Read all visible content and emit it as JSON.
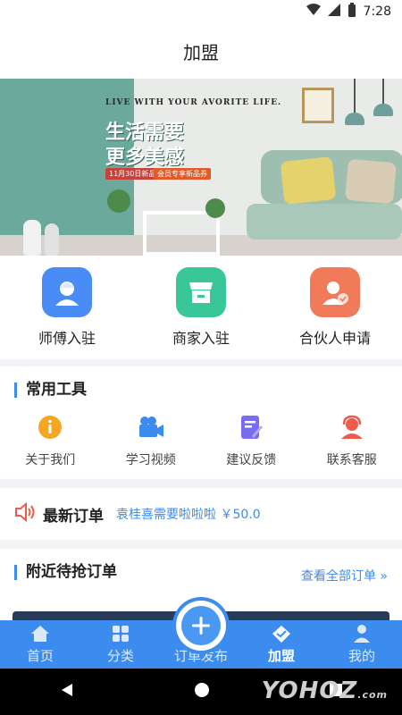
{
  "status": {
    "time": "7:28"
  },
  "header": {
    "title": "加盟"
  },
  "banner": {
    "slogan": "LIVE WITH YOUR AVORITE LIFE.",
    "headline1": "生活需要",
    "headline2": "更多美感",
    "tag_date": "11月30日新品",
    "tag_member": "会员专享新品券"
  },
  "roles": [
    {
      "label": "师傅入驻",
      "icon": "worker-icon",
      "color": "#4a8cf5"
    },
    {
      "label": "商家入驻",
      "icon": "shop-icon",
      "color": "#39c79a"
    },
    {
      "label": "合伙人申请",
      "icon": "partner-icon",
      "color": "#f07a5a"
    }
  ],
  "tools": {
    "title": "常用工具",
    "items": [
      {
        "label": "关于我们",
        "icon": "info-icon"
      },
      {
        "label": "学习视频",
        "icon": "video-icon"
      },
      {
        "label": "建议反馈",
        "icon": "feedback-icon"
      },
      {
        "label": "联系客服",
        "icon": "support-icon"
      }
    ]
  },
  "latest_orders": {
    "title": "最新订单",
    "text": "袁桂喜需要啦啦啦 ￥50.0"
  },
  "nearby": {
    "title": "附近待抢订单",
    "view_all": "查看全部订单 »"
  },
  "tabs": [
    {
      "label": "首页",
      "icon": "home-icon"
    },
    {
      "label": "分类",
      "icon": "grid-icon"
    },
    {
      "label": "订单发布",
      "icon": "plus-icon"
    },
    {
      "label": "加盟",
      "icon": "handshake-icon"
    },
    {
      "label": "我的",
      "icon": "user-icon"
    }
  ],
  "watermark": {
    "text": "YOHOZ",
    "suffix": ".com"
  },
  "colors": {
    "accent": "#3c8cf0"
  }
}
